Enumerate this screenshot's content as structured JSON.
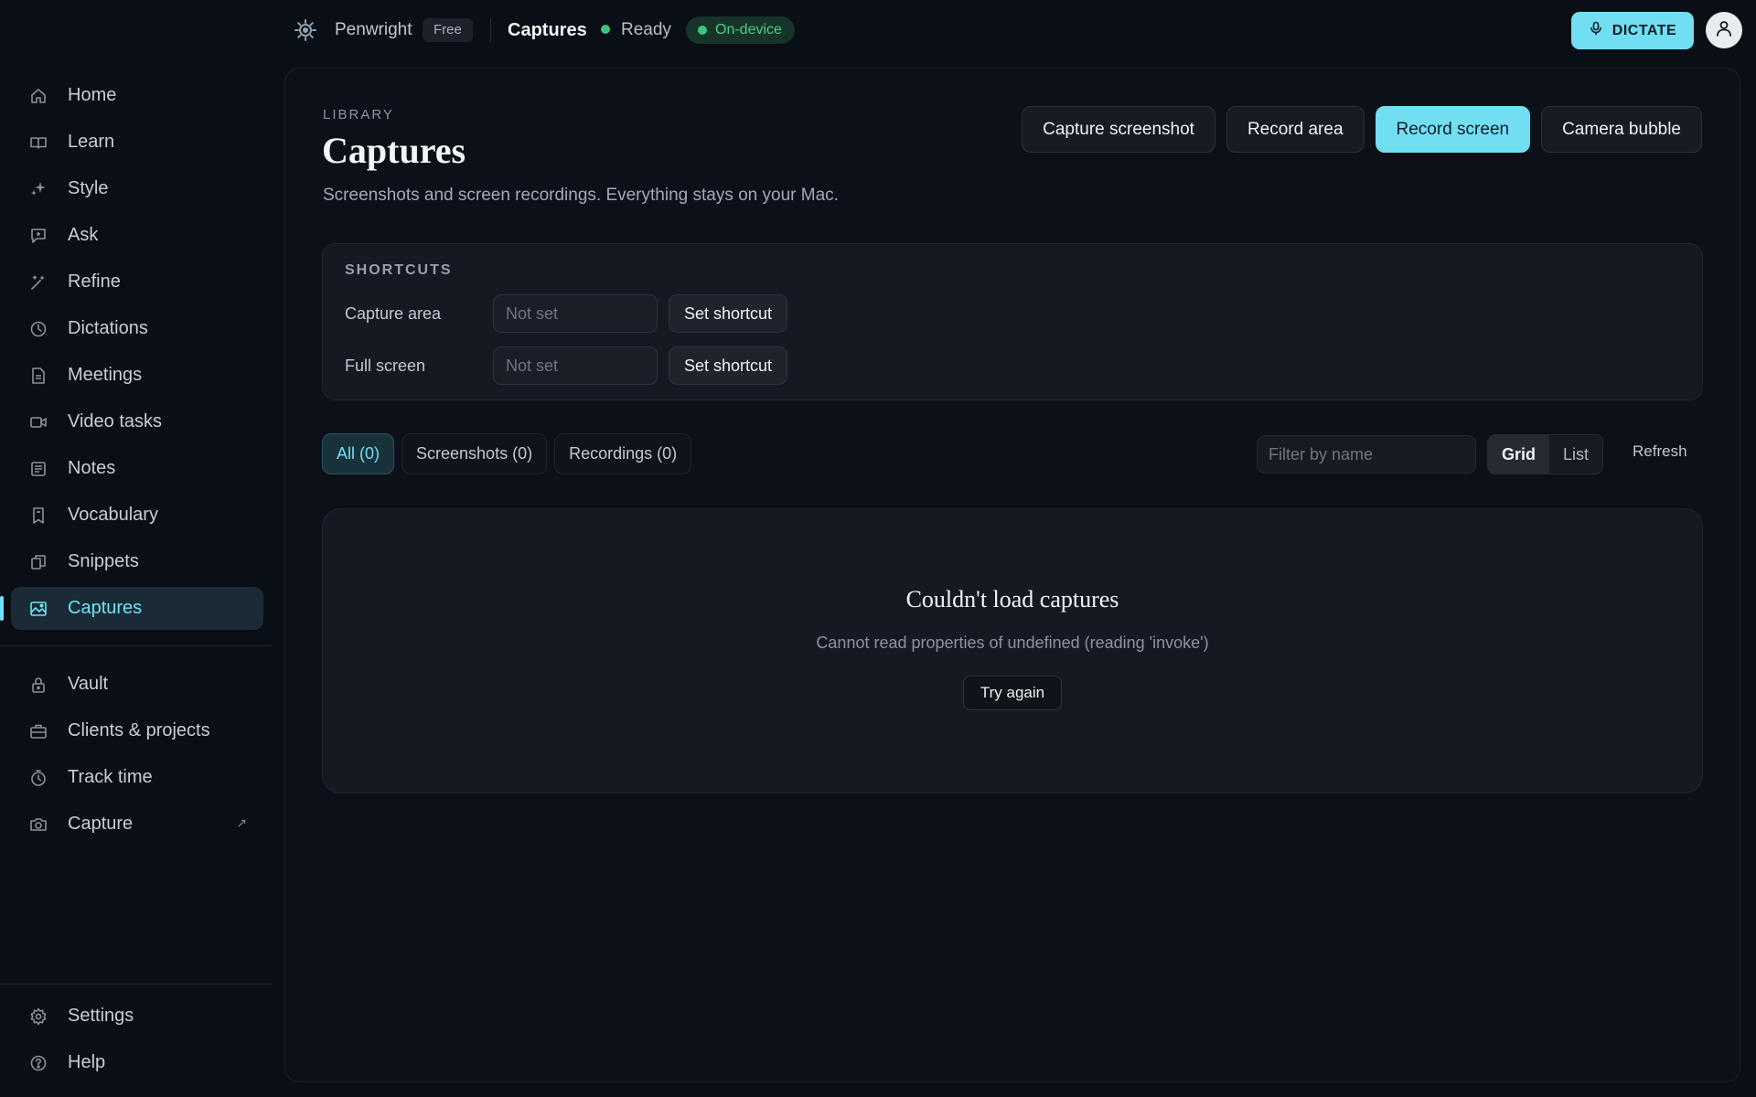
{
  "app": {
    "name": "Penwright",
    "plan_badge": "Free"
  },
  "topbar": {
    "breadcrumb": "Captures",
    "status": "Ready",
    "mode_badge": "On-device",
    "dictate_label": "DICTATE"
  },
  "sidebar": {
    "items": [
      {
        "label": "Home",
        "icon": "home-icon"
      },
      {
        "label": "Learn",
        "icon": "book-icon"
      },
      {
        "label": "Style",
        "icon": "sparkle-icon"
      },
      {
        "label": "Ask",
        "icon": "chat-icon"
      },
      {
        "label": "Refine",
        "icon": "wand-icon"
      },
      {
        "label": "Dictations",
        "icon": "clock-icon"
      },
      {
        "label": "Meetings",
        "icon": "document-icon"
      },
      {
        "label": "Video tasks",
        "icon": "video-icon"
      },
      {
        "label": "Notes",
        "icon": "notes-icon"
      },
      {
        "label": "Vocabulary",
        "icon": "bookmark-icon"
      },
      {
        "label": "Snippets",
        "icon": "snippets-icon"
      },
      {
        "label": "Captures",
        "icon": "image-icon",
        "active": true
      }
    ],
    "secondary": [
      {
        "label": "Vault",
        "icon": "lock-icon"
      },
      {
        "label": "Clients & projects",
        "icon": "briefcase-icon"
      },
      {
        "label": "Track time",
        "icon": "stopwatch-icon"
      },
      {
        "label": "Capture",
        "icon": "camera-icon",
        "external": "↗"
      }
    ],
    "footer": [
      {
        "label": "Settings",
        "icon": "gear-icon"
      },
      {
        "label": "Help",
        "icon": "help-icon"
      }
    ]
  },
  "page": {
    "overline": "LIBRARY",
    "title": "Captures",
    "subtitle": "Screenshots and screen recordings. Everything stays on your Mac.",
    "actions": {
      "capture_screenshot": "Capture screenshot",
      "record_area": "Record area",
      "record_screen": "Record screen",
      "camera_bubble": "Camera bubble"
    }
  },
  "shortcuts": {
    "title": "SHORTCUTS",
    "rows": [
      {
        "label": "Capture area",
        "value": "Not set",
        "button": "Set shortcut"
      },
      {
        "label": "Full screen",
        "value": "Not set",
        "button": "Set shortcut"
      }
    ]
  },
  "filters": {
    "tabs": [
      "All (0)",
      "Screenshots (0)",
      "Recordings (0)"
    ],
    "active_tab": "All (0)",
    "search_placeholder": "Filter by name",
    "search_value": "",
    "views": [
      "Grid",
      "List"
    ],
    "active_view": "Grid",
    "refresh_label": "Refresh"
  },
  "error": {
    "title": "Couldn't load captures",
    "message": "Cannot read properties of undefined (reading 'invoke')",
    "retry_label": "Try again"
  },
  "colors": {
    "accent": "#72def2",
    "success": "#39c777",
    "background": "#0a0e15",
    "panel": "#141922"
  }
}
